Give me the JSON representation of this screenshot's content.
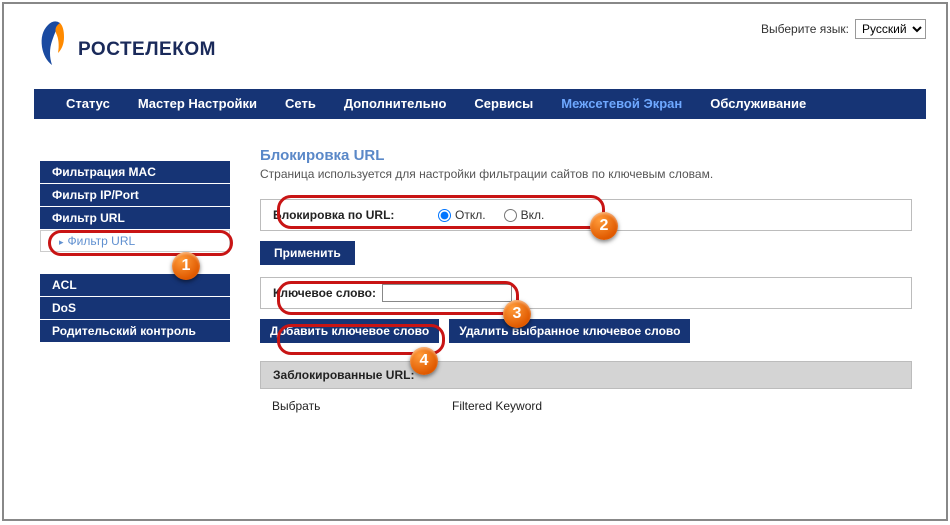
{
  "lang": {
    "label": "Выберите язык:",
    "selected": "Русский"
  },
  "brand": "РОСТЕЛЕКОМ",
  "nav": {
    "items": [
      "Статус",
      "Мастер Настройки",
      "Сеть",
      "Дополнительно",
      "Сервисы",
      "Межсетевой Экран",
      "Обслуживание"
    ],
    "active_index": 5
  },
  "sidebar": {
    "top": [
      "Фильтрация MAC",
      "Фильтр IP/Port",
      "Фильтр URL"
    ],
    "sub": "Фильтр URL",
    "bottom": [
      "ACL",
      "DoS",
      "Родительский контроль"
    ]
  },
  "page": {
    "title": "Блокировка URL",
    "desc": "Страница используется для настройки фильтрации сайтов по ключевым словам."
  },
  "url_block": {
    "label": "Блокировка по URL:",
    "off": "Откл.",
    "on": "Вкл."
  },
  "apply": "Применить",
  "kw": {
    "label": "Ключевое слово:",
    "value": ""
  },
  "buttons": {
    "add": "Добавить ключевое слово",
    "del": "Удалить выбранное ключевое слово"
  },
  "blocked": {
    "header": "Заблокированные URL:",
    "col1": "Выбрать",
    "col2": "Filtered Keyword"
  },
  "badges": {
    "b1": "1",
    "b2": "2",
    "b3": "3",
    "b4": "4"
  }
}
